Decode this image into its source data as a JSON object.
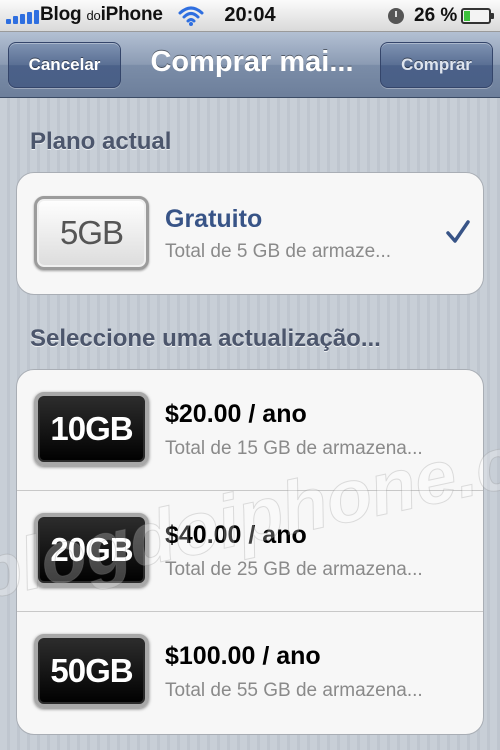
{
  "status_bar": {
    "carrier_main": "Blog",
    "carrier_small": "do",
    "carrier_end": "iPhone",
    "time": "20:04",
    "battery_percent": "26 %",
    "battery_level": 0.26,
    "icons": [
      "signal-bars-icon",
      "wifi-icon",
      "lock-rotation-icon",
      "battery-icon"
    ]
  },
  "nav": {
    "cancel_label": "Cancelar",
    "title": "Comprar mai...",
    "buy_label": "Comprar"
  },
  "current_plan": {
    "header": "Plano actual",
    "badge": "5GB",
    "name": "Gratuito",
    "description": "Total de 5 GB de armaze...",
    "selected": true
  },
  "upgrades": {
    "header": "Seleccione uma actualização...",
    "items": [
      {
        "badge": "10GB",
        "price": "$20.00 / ano",
        "description": "Total de 15 GB de armazena..."
      },
      {
        "badge": "20GB",
        "price": "$40.00 / ano",
        "description": "Total de 25 GB de armazena..."
      },
      {
        "badge": "50GB",
        "price": "$100.00 / ano",
        "description": "Total de 55 GB de armazena..."
      }
    ]
  },
  "watermark": "blogdoiphone.com",
  "colors": {
    "nav_bar": "#7b8da8",
    "price_text": "#000000",
    "current_plan_text": "#385487",
    "checkmark": "#385487",
    "battery_fill": "#3ec13e"
  }
}
